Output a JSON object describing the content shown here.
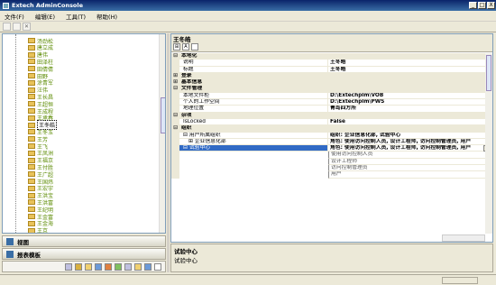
{
  "window": {
    "title": "Extech AdminConsole",
    "min": "_",
    "max": "□",
    "close": "X"
  },
  "menu": [
    "文件(F)",
    "编辑(E)",
    "工具(T)",
    "帮助(H)"
  ],
  "tree": {
    "items": [
      "汤劲松",
      "唐立成",
      "唐伟",
      "田泽柱",
      "田倩倩",
      "田野",
      "涂青军",
      "汪伟",
      "王长昌",
      "王超恒",
      "王成程",
      "王承春",
      "王冬皓",
      "王冬玉",
      "王芳",
      "王飞",
      "王凤洲",
      "王福京",
      "王付胜",
      "王广超",
      "王国炜",
      "王宏宇",
      "王洪宝",
      "王洪富",
      "王纪明",
      "王金富",
      "王金海",
      "王京"
    ],
    "selected_index": 12
  },
  "nav": {
    "view": "视图",
    "report": "报表模板"
  },
  "props": {
    "object_name": "王冬皓",
    "rows": [
      {
        "kind": "cat",
        "sign": "⊟",
        "name": "本地化",
        "value": ""
      },
      {
        "kind": "item",
        "name": "说明",
        "value": "王冬皓"
      },
      {
        "kind": "item",
        "name": "标题",
        "value": "王冬皓"
      },
      {
        "kind": "cat",
        "sign": "⊞",
        "name": "登录",
        "value": ""
      },
      {
        "kind": "cat",
        "sign": "⊞",
        "name": "基本信息",
        "value": ""
      },
      {
        "kind": "cat",
        "sign": "⊟",
        "name": "文件管理",
        "value": ""
      },
      {
        "kind": "item",
        "name": "本地文件柜",
        "value": "D:\\Extechplm\\VOB"
      },
      {
        "kind": "item",
        "name": "个人的工作空间",
        "value": "D:\\Extechplm\\PWS"
      },
      {
        "kind": "item",
        "name": "地理位置",
        "value": "青岛四方所"
      },
      {
        "kind": "cat",
        "sign": "⊟",
        "name": "杂项",
        "value": ""
      },
      {
        "kind": "item",
        "name": "IsLocked",
        "value": "False"
      },
      {
        "kind": "cat",
        "sign": "⊟",
        "name": "组织",
        "value": ""
      },
      {
        "kind": "item",
        "sign": "⊟",
        "name": "用户所属组织",
        "value": "组织: 企业信息化部, 试验中心"
      },
      {
        "kind": "sub",
        "sign": "⊞",
        "name": "企业信息化部",
        "value": "角色: 使用访问控制人员, 设计工程师, 访问控制管理员, 用户"
      },
      {
        "kind": "sel",
        "sign": "⊟",
        "name": "试验中心",
        "value": "角色: 使用访问控制人员, 设计工程师, 访问控制管理员, 用户"
      },
      {
        "kind": "dd",
        "name": "",
        "value": "使用访问控制人员"
      },
      {
        "kind": "dd",
        "name": "",
        "value": "设计工程师"
      },
      {
        "kind": "dd",
        "name": "",
        "value": "访问控制管理员"
      },
      {
        "kind": "dd",
        "name": "",
        "value": "用户"
      }
    ]
  },
  "description": {
    "title": "试验中心",
    "text": "试验中心"
  }
}
